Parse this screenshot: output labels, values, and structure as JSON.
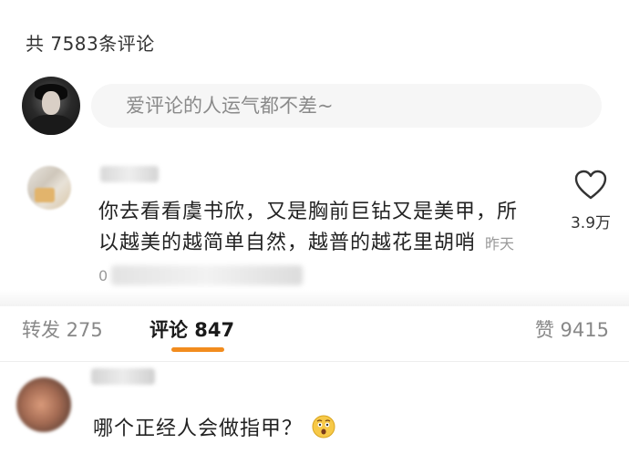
{
  "header": {
    "total_comments": "共 7583条评论"
  },
  "composer": {
    "placeholder": "爱评论的人运气都不差~"
  },
  "top_comment": {
    "text": "你去看看虞书欣，又是胸前巨钻又是美甲，所以越美的越简单自然，越普的越花里胡哨",
    "time": "昨天 0",
    "like_count": "3.9万",
    "like_icon": "heart-outline-icon"
  },
  "tabs": {
    "repost": "转发 275",
    "comment": "评论 847",
    "like": "赞 9415",
    "active_color": "#f28c1e"
  },
  "reply": {
    "text": "哪个正经人会做指甲？",
    "emoji": "thinking-face-icon"
  }
}
